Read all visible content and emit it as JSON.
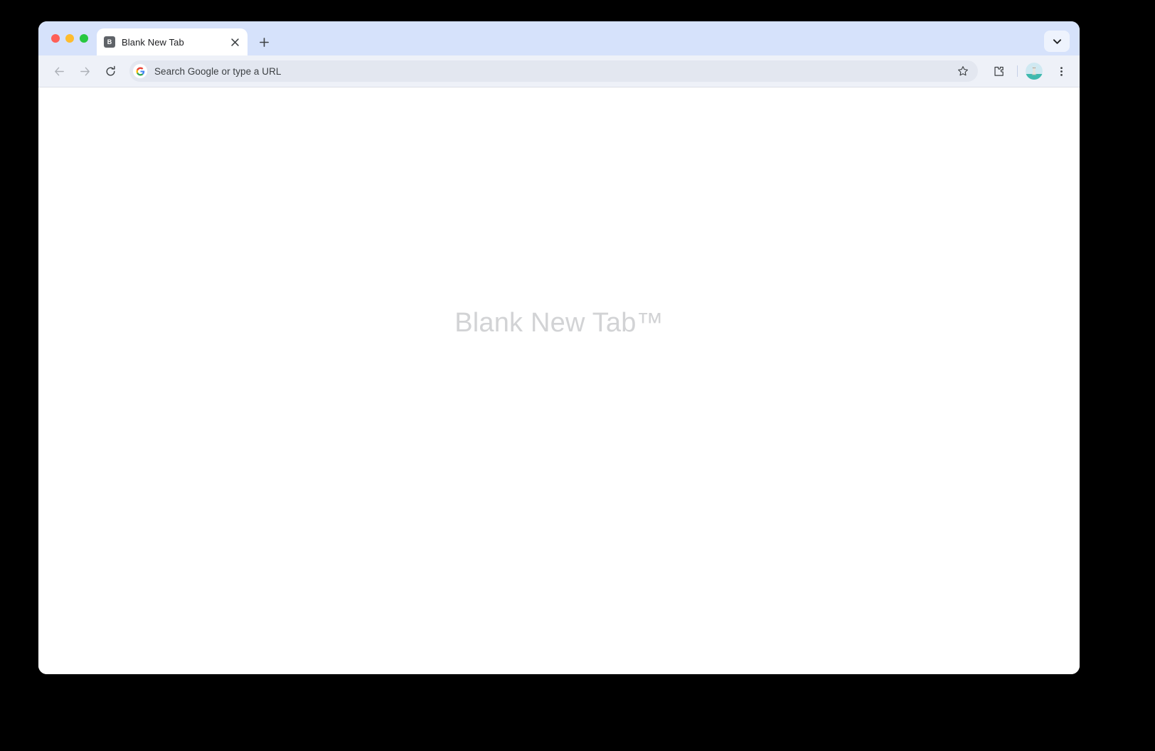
{
  "window": {
    "traffic_lights": [
      {
        "name": "close",
        "color": "#ff5f57"
      },
      {
        "name": "minimize",
        "color": "#febc2e"
      },
      {
        "name": "maximize",
        "color": "#28c840"
      }
    ],
    "chrome_color": "#d6e2fb",
    "toolbar_color": "#eef1f8"
  },
  "tab_strip": {
    "tabs": [
      {
        "title": "Blank New Tab",
        "favicon_letter": "B",
        "favicon_color": "#5f6368",
        "active": true,
        "close_label": "Close"
      }
    ],
    "new_tab_label": "New tab",
    "tab_search_label": "Search tabs"
  },
  "toolbar": {
    "back_label": "Back",
    "forward_label": "Forward",
    "reload_label": "Reload this page",
    "omnibox": {
      "value": "",
      "placeholder": "Search Google or type a URL",
      "search_engine": "Google"
    },
    "bookmark_label": "Bookmark this tab",
    "extensions_label": "Extensions",
    "profile_label": "Profile",
    "menu_label": "Customize and control Google Chrome"
  },
  "page": {
    "heading": "Blank New Tab™",
    "heading_color": "#d2d3d5",
    "background": "#ffffff"
  }
}
